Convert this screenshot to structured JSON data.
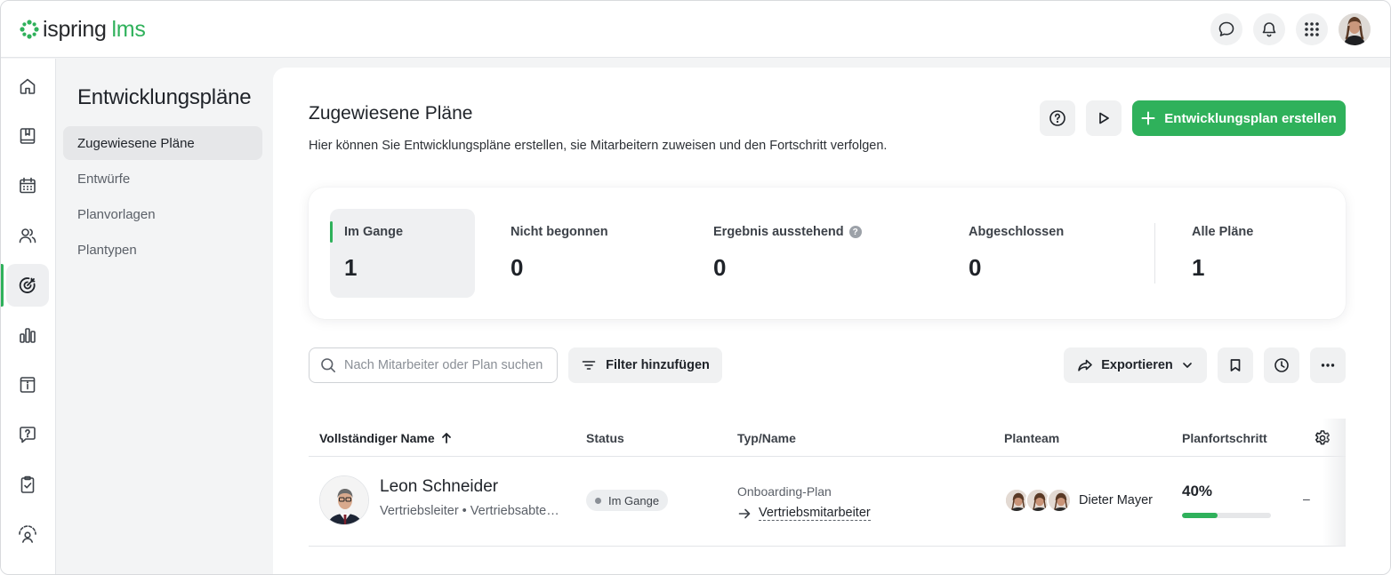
{
  "app": {
    "brand": "ispring",
    "brand_suffix": "lms",
    "accent_color": "#2fb15b"
  },
  "topbar": {
    "icons": [
      "chat-icon",
      "bell-icon",
      "apps-grid-icon",
      "user-avatar"
    ]
  },
  "rail": {
    "items": [
      "home-icon",
      "book-icon",
      "calendar-icon",
      "users-icon",
      "target-icon",
      "chart-icon",
      "info-card-icon",
      "question-chat-icon",
      "clipboard-check-icon",
      "gauge-user-icon"
    ],
    "active": "target-icon"
  },
  "sidenav": {
    "title": "Entwicklungspläne",
    "items": [
      {
        "label": "Zugewiesene Pläne",
        "active": true
      },
      {
        "label": "Entwürfe",
        "active": false
      },
      {
        "label": "Planvorlagen",
        "active": false
      },
      {
        "label": "Plantypen",
        "active": false
      }
    ]
  },
  "page": {
    "title": "Zugewiesene Pläne",
    "subtitle": "Hier können Sie Entwicklungspläne erstellen, sie Mitarbeitern zuweisen und den Fortschritt verfolgen.",
    "create_label": "Entwicklungsplan erstellen"
  },
  "stats": [
    {
      "label": "Im Gange",
      "value": "1",
      "active": true
    },
    {
      "label": "Nicht begonnen",
      "value": "0"
    },
    {
      "label": "Ergebnis ausstehend",
      "value": "0",
      "help": "?"
    },
    {
      "label": "Abgeschlossen",
      "value": "0"
    },
    {
      "label": "Alle Pläne",
      "value": "1"
    }
  ],
  "toolbar": {
    "search_placeholder": "Nach Mitarbeiter oder Plan suchen",
    "filter_label": "Filter hinzufügen",
    "export_label": "Exportieren"
  },
  "table": {
    "columns": [
      "Vollständiger Name",
      "Status",
      "Typ/Name",
      "Planteam",
      "Planfortschritt"
    ],
    "sort": {
      "column": "Vollständiger Name",
      "direction": "asc"
    },
    "rows": [
      {
        "name": "Leon Schneider",
        "meta": "Vertriebsleiter • Vertriebsabteilung",
        "status": "Im Gange",
        "plan_type": "Onboarding-Plan",
        "plan_name": "Vertriebsmitarbeiter",
        "team_name": "Dieter Mayer",
        "progress_label": "40%",
        "progress": 0.4,
        "last": "–"
      }
    ]
  }
}
